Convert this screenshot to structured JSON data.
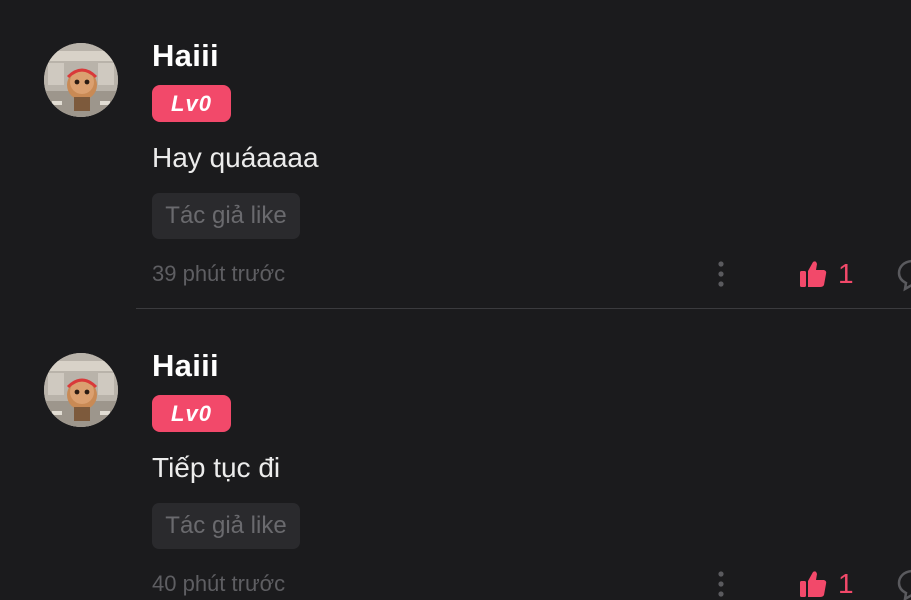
{
  "colors": {
    "background": "#1b1b1d",
    "accent": "#f2496a",
    "divider": "#3b3b3e",
    "muted_text": "#5e5e62",
    "tag_background": "#2a2a2d"
  },
  "icons": {
    "more": "more-vertical-icon",
    "like": "thumbs-up-icon",
    "reply": "comment-bubble-icon"
  },
  "comments": [
    {
      "username": "Haiii",
      "level": "Lv0",
      "text": "Hay quáaaaa",
      "author_tag": "Tác giả like",
      "time": "39 phút trước",
      "likes": "1"
    },
    {
      "username": "Haiii",
      "level": "Lv0",
      "text": "Tiếp tục đi",
      "author_tag": "Tác giả like",
      "time": "40 phút trước",
      "likes": "1"
    }
  ]
}
